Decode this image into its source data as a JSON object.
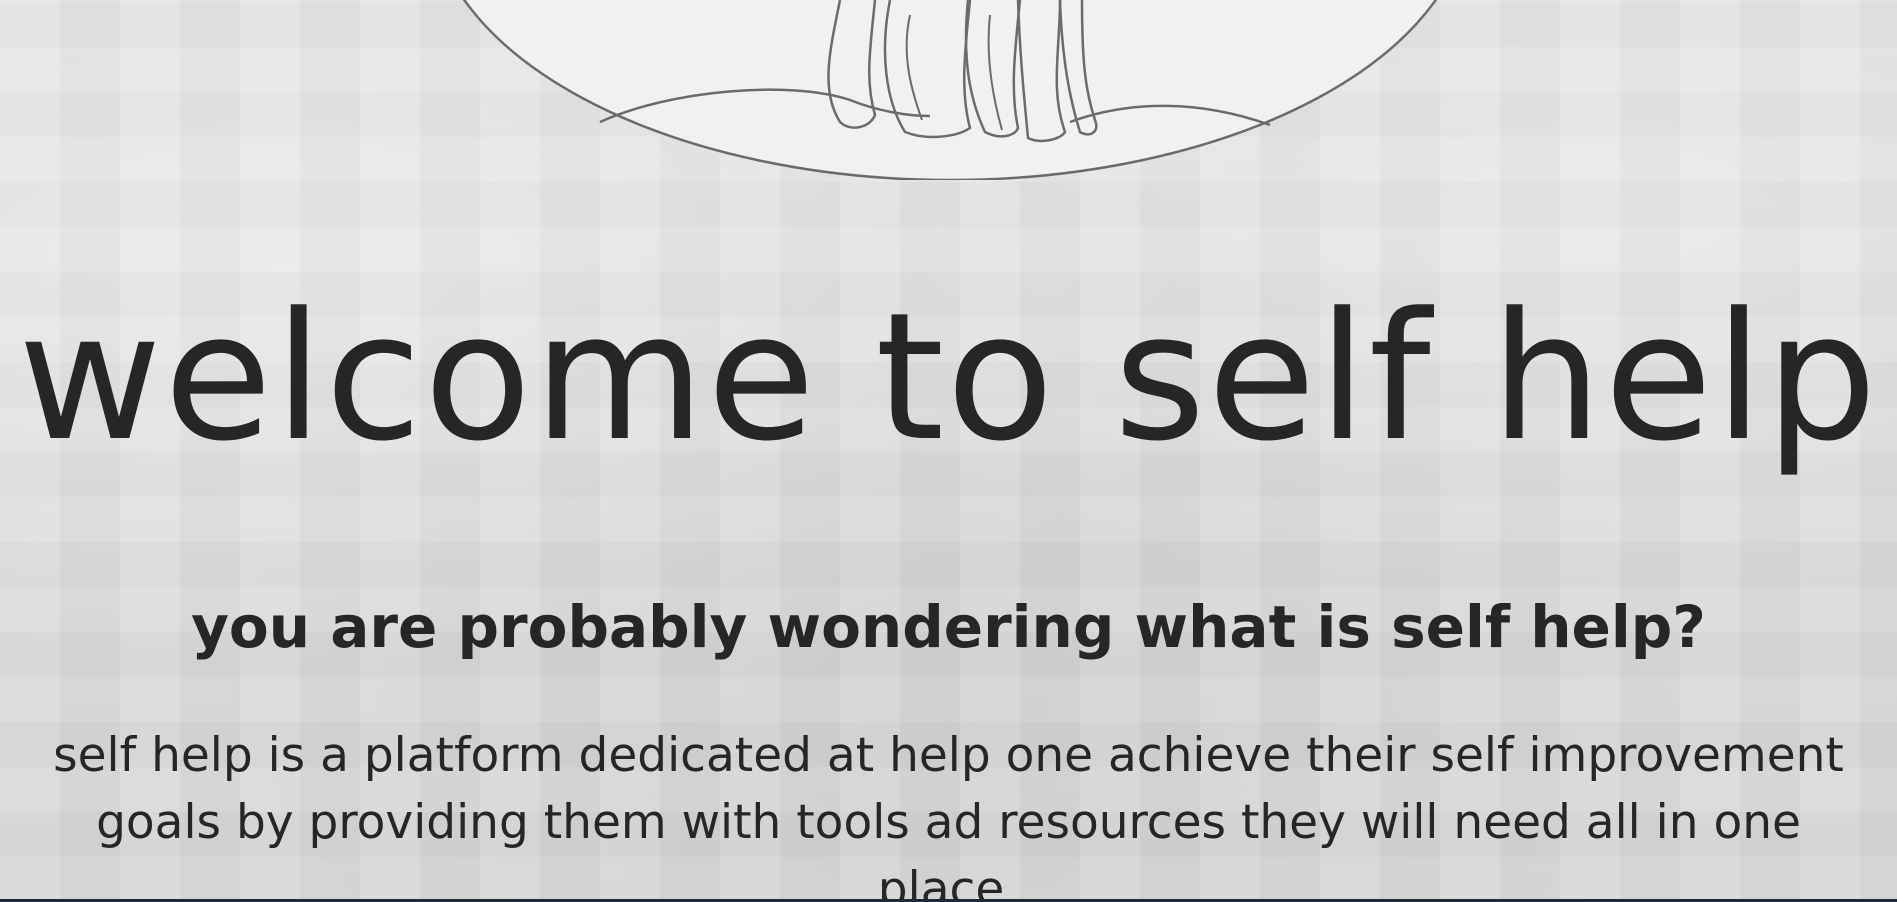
{
  "hero": {
    "title": "welcome to self help",
    "subtitle": "you are probably wondering what is self help?",
    "description": "self help is a platform dedicated at help one achieve their self improvement goals by providing them with tools ad resources they will need all in one place."
  },
  "logo": {
    "icon": "line-art-figures-logo"
  },
  "colors": {
    "background": "#dcdddc",
    "text": "#262626",
    "logo_fill": "#f1f1f0",
    "logo_stroke": "#6b6b6b"
  }
}
